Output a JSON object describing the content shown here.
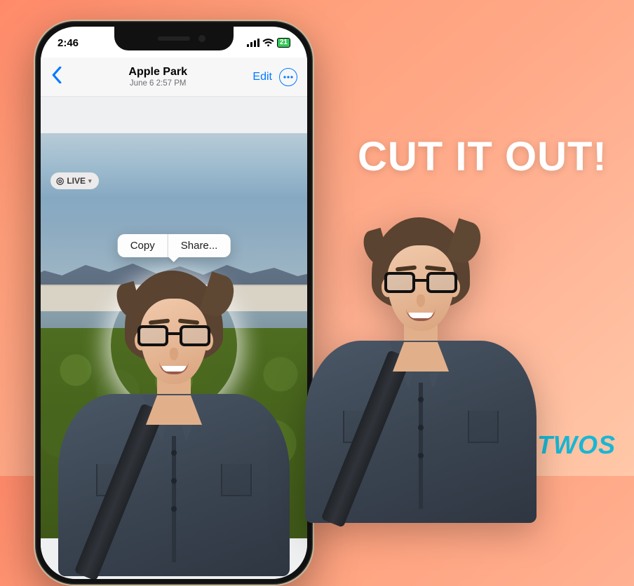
{
  "statusbar": {
    "time": "2:46",
    "battery_percent": "21"
  },
  "navbar": {
    "title": "Apple Park",
    "subtitle": "June 6  2:57 PM",
    "edit_label": "Edit"
  },
  "live_badge": {
    "label": "LIVE"
  },
  "context_menu": {
    "copy_label": "Copy",
    "share_label": "Share..."
  },
  "headline": "CUT IT OUT!",
  "brand": {
    "name": "TWOS"
  }
}
